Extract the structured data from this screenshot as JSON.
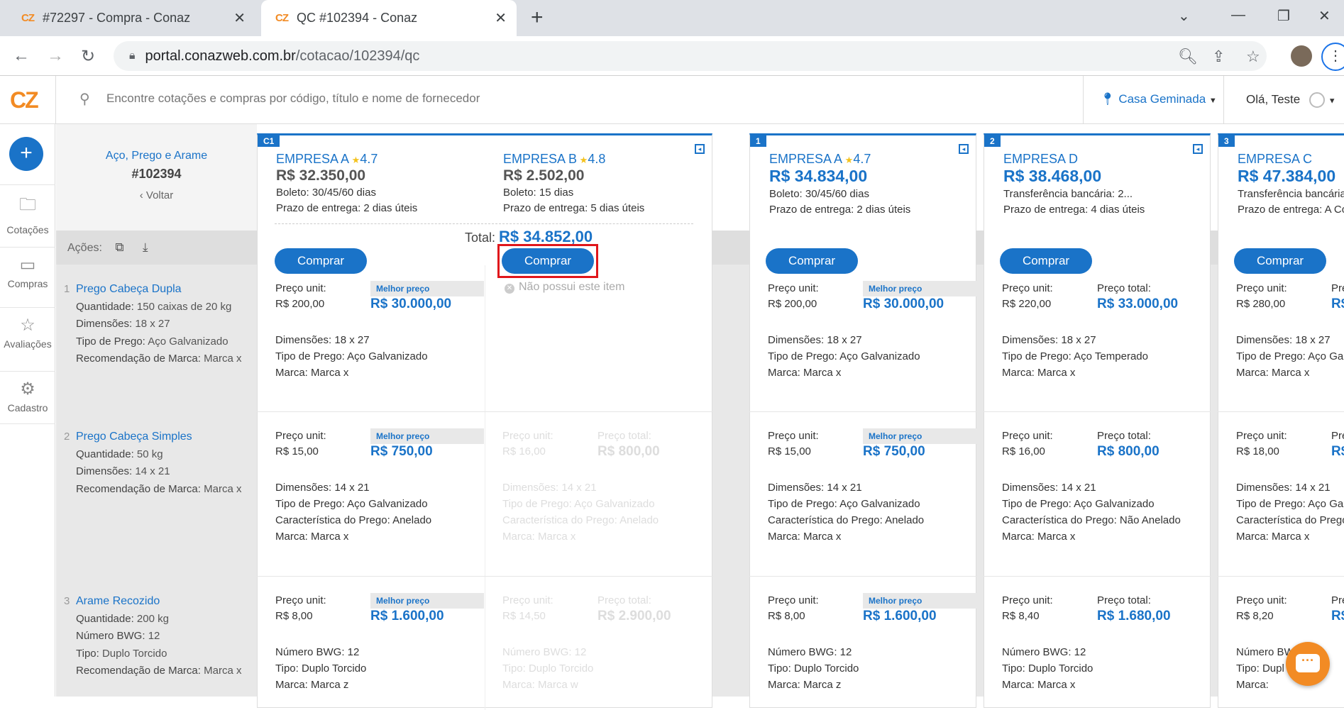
{
  "browser": {
    "tabs": [
      {
        "favicon": "CZ",
        "title": "#72297 - Compra - Conaz"
      },
      {
        "favicon": "CZ",
        "title": "QC #102394 - Conaz"
      }
    ],
    "url_host": "portal.conazweb.com.br",
    "url_path": "/cotacao/102394/qc"
  },
  "header": {
    "logo": "CZ",
    "search_placeholder": "Encontre cotações e compras por código, título e nome de fornecedor",
    "location": "Casa Geminada",
    "greeting": "Olá, Teste"
  },
  "leftnav": {
    "items": [
      {
        "label": "Cotações",
        "icon": "folder-icon"
      },
      {
        "label": "Compras",
        "icon": "card-icon"
      },
      {
        "label": "Avaliações",
        "icon": "star-icon"
      },
      {
        "label": "Cadastro",
        "icon": "gear-icon"
      }
    ]
  },
  "quote": {
    "title": "Aço, Prego e Arame",
    "code": "#102394",
    "back": "‹ Voltar",
    "actions_label": "Ações:"
  },
  "items": [
    {
      "num": "1",
      "name": "Prego Cabeça Dupla",
      "specs": [
        [
          "Quantidade:",
          "150 caixas de 20 kg"
        ],
        [
          "Dimensões:",
          "18 x 27"
        ],
        [
          "Tipo de Prego:",
          "Aço Galvanizado"
        ],
        [
          "Recomendação de Marca:",
          "Marca x"
        ]
      ]
    },
    {
      "num": "2",
      "name": "Prego Cabeça Simples",
      "specs": [
        [
          "Quantidade:",
          "50 kg"
        ],
        [
          "Dimensões:",
          "14 x 21"
        ],
        [
          "Recomendação de Marca:",
          "Marca x"
        ]
      ]
    },
    {
      "num": "3",
      "name": "Arame Recozido",
      "specs": [
        [
          "Quantidade:",
          "200 kg"
        ],
        [
          "Número BWG:",
          "12"
        ],
        [
          "Tipo:",
          "Duplo Torcido"
        ],
        [
          "Recomendação de Marca:",
          "Marca x"
        ]
      ]
    }
  ],
  "labels": {
    "unit_price": "Preço unit:",
    "best_price": "Melhor preço",
    "total_price": "Preço total:",
    "buy": "Comprar",
    "no_item": "Não possui este item",
    "total": "Total:"
  },
  "cards": [
    {
      "badge": "C1",
      "total": "R$ 34.852,00",
      "suppliers": [
        {
          "name": "EMPRESA A",
          "rating": "4.7",
          "price": "R$ 32.350,00",
          "payment": "Boleto: 30/45/60 dias",
          "delivery": "Prazo de entrega:  2 dias úteis"
        },
        {
          "name": "EMPRESA B",
          "rating": "4.8",
          "price": "R$ 2.502,00",
          "payment": "Boleto: 15 dias",
          "delivery": "Prazo de entrega:  5 dias úteis"
        }
      ]
    },
    {
      "badge": "1",
      "name": "EMPRESA A",
      "rating": "4.7",
      "price": "R$ 34.834,00",
      "payment": "Boleto: 30/45/60 dias",
      "delivery": "Prazo de entrega:  2 dias úteis"
    },
    {
      "badge": "2",
      "name": "EMPRESA D",
      "price": "R$ 38.468,00",
      "payment": "Transferência bancária: 2...",
      "delivery": "Prazo de entrega:  4 dias úteis"
    },
    {
      "badge": "3",
      "name": "EMPRESA C",
      "price": "R$ 47.384,00",
      "payment": "Transferência bancária",
      "delivery": "Prazo de entrega:  A Co"
    }
  ],
  "cells": {
    "c1a": [
      {
        "unit": "R$ 200,00",
        "total": "R$ 30.000,00",
        "specs": [
          "Dimensões:  18 x 27",
          "Tipo de Prego:  Aço Galvanizado",
          "Marca:  Marca x"
        ]
      },
      {
        "unit": "R$ 15,00",
        "total": "R$ 750,00",
        "specs": [
          "Dimensões:  14 x 21",
          "Tipo de Prego:  Aço Galvanizado",
          "Característica do Prego:  Anelado",
          "Marca:  Marca x"
        ]
      },
      {
        "unit": "R$ 8,00",
        "total": "R$ 1.600,00",
        "specs": [
          "Número BWG:  12",
          "Tipo:  Duplo Torcido",
          "Marca:  Marca z"
        ]
      }
    ],
    "c1b": [
      {},
      {
        "unit": "R$ 16,00",
        "total": "R$ 800,00",
        "specs": [
          "Dimensões:  14 x 21",
          "Tipo de Prego:  Aço Galvanizado",
          "Característica do Prego:  Anelado",
          "Marca:  Marca x"
        ]
      },
      {
        "unit": "R$ 14,50",
        "total": "R$ 2.900,00",
        "specs": [
          "Número BWG:  12",
          "Tipo:  Duplo Torcido",
          "Marca:  Marca w"
        ]
      }
    ],
    "c2": [
      {
        "unit": "R$ 200,00",
        "total": "R$ 30.000,00",
        "specs": [
          "Dimensões:  18 x 27",
          "Tipo de Prego:  Aço Galvanizado",
          "Marca:  Marca x"
        ]
      },
      {
        "unit": "R$ 15,00",
        "total": "R$ 750,00",
        "specs": [
          "Dimensões:  14 x 21",
          "Tipo de Prego:  Aço Galvanizado",
          "Característica do Prego:  Anelado",
          "Marca:  Marca x"
        ]
      },
      {
        "unit": "R$ 8,00",
        "total": "R$ 1.600,00",
        "specs": [
          "Número BWG:  12",
          "Tipo:  Duplo Torcido",
          "Marca:  Marca z"
        ]
      }
    ],
    "c3": [
      {
        "unit": "R$ 220,00",
        "total": "R$ 33.000,00",
        "specs": [
          "Dimensões:  18 x 27",
          "Tipo de Prego:  Aço Temperado",
          "Marca:  Marca x"
        ]
      },
      {
        "unit": "R$ 16,00",
        "total": "R$ 800,00",
        "specs": [
          "Dimensões:  14 x 21",
          "Tipo de Prego:  Aço Galvanizado",
          "Característica do Prego:  Não Anelado",
          "Marca:  Marca x"
        ]
      },
      {
        "unit": "R$ 8,40",
        "total": "R$ 1.680,00",
        "specs": [
          "Número BWG:  12",
          "Tipo:  Duplo Torcido",
          "Marca:  Marca x"
        ]
      }
    ],
    "c4": [
      {
        "unit": "R$ 280,00",
        "total": "R$",
        "specs": [
          "Dimensões:  18 x 27",
          "Tipo de Prego:  Aço Galv",
          "Marca:  Marca x"
        ]
      },
      {
        "unit": "R$ 18,00",
        "total": "R$",
        "specs": [
          "Dimensões:  14 x 21",
          "Tipo de Prego:  Aço Galv",
          "Característica do Prego",
          "Marca:  Marca x"
        ]
      },
      {
        "unit": "R$ 8,20",
        "total": "R$",
        "specs": [
          "Número BW",
          "Tipo:  Dupl",
          "Marca:"
        ]
      }
    ]
  }
}
